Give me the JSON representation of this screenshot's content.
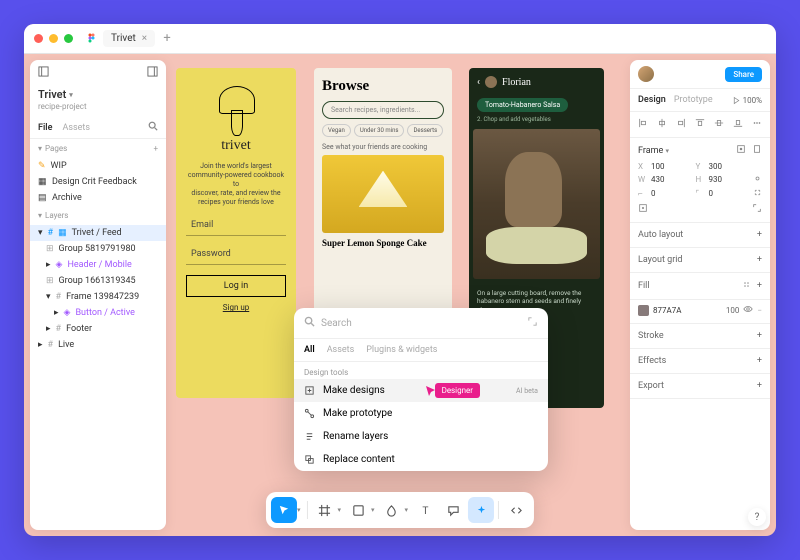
{
  "tab": {
    "name": "Trivet"
  },
  "project": {
    "title": "Trivet",
    "subtitle": "recipe-project"
  },
  "leftTabs": {
    "file": "File",
    "assets": "Assets"
  },
  "pages": {
    "label": "Pages",
    "items": [
      "WIP",
      "Design Crit Feedback",
      "Archive"
    ]
  },
  "layers": {
    "label": "Layers",
    "items": [
      {
        "name": "Trivet / Feed",
        "selected": true
      },
      {
        "name": "Group 5819791980"
      },
      {
        "name": "Header / Mobile",
        "component": true
      },
      {
        "name": "Group 1661319345"
      },
      {
        "name": "Frame 139847239"
      },
      {
        "name": "Button / Active",
        "component": true,
        "nested": true
      },
      {
        "name": "Footer"
      },
      {
        "name": "Live"
      }
    ]
  },
  "artboard1": {
    "brand": "trivet",
    "copy": "Join the world's largest\ncommunity-powered cookbook to\ndiscover, rate, and review the\nrecipes your friends love",
    "email": "Email",
    "password": "Password",
    "login": "Log in",
    "signup": "Sign up"
  },
  "artboard2": {
    "title": "Browse",
    "placeholder": "Search recipes, ingredients...",
    "chips": [
      "Vegan",
      "Under 30 mins",
      "Desserts"
    ],
    "friends": "See what your friends are cooking",
    "recipe": "Super Lemon Sponge Cake"
  },
  "artboard3": {
    "author": "Florian",
    "step": "Tomato-Habanero Salsa",
    "substep": "2. Chop and add vegetables",
    "caption": "On a large cutting board, remove the habanero stem and seeds and finely chop.\n\nSlice the onions then..."
  },
  "search": {
    "placeholder": "Search",
    "tabs": {
      "all": "All",
      "assets": "Assets",
      "plugins": "Plugins & widgets"
    },
    "section": "Design tools",
    "items": [
      "Make designs",
      "Make prototype",
      "Rename layers",
      "Replace content"
    ],
    "badge": "AI beta",
    "cursor_tag": "Designer"
  },
  "right": {
    "share": "Share",
    "tabs": {
      "design": "Design",
      "prototype": "Prototype"
    },
    "zoom": "100%",
    "frame": "Frame",
    "dims": {
      "x": "100",
      "y": "300",
      "w": "430",
      "h": "930",
      "r1": "0",
      "r2": "0"
    },
    "sections": {
      "autolayout": "Auto layout",
      "layoutgrid": "Layout grid",
      "fill": "Fill",
      "stroke": "Stroke",
      "effects": "Effects",
      "export": "Export"
    },
    "fill": {
      "hex": "877A7A",
      "opacity": "100"
    }
  },
  "help": "?"
}
